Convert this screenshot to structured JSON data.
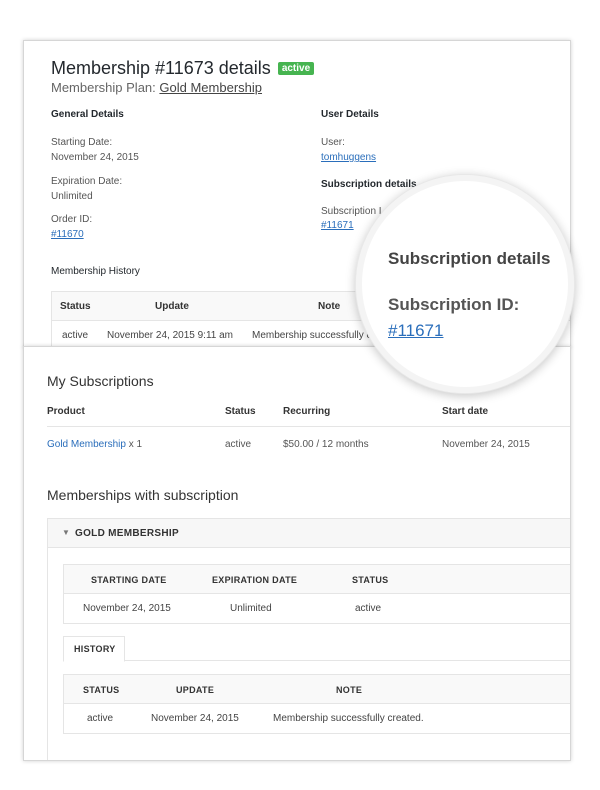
{
  "membership": {
    "title": "Membership #11673 details",
    "status_badge": "active",
    "plan_label": "Membership Plan:",
    "plan_name": "Gold Membership",
    "general_heading": "General Details",
    "starting_date_label": "Starting Date:",
    "starting_date": "November 24, 2015",
    "expiration_date_label": "Expiration Date:",
    "expiration_date": "Unlimited",
    "order_id_label": "Order ID:",
    "order_id": "#11670",
    "user_heading": "User Details",
    "user_label": "User:",
    "user": "tomhuggens",
    "subscription_heading": "Subscription details",
    "subscription_id_label": "Subscription I",
    "subscription_id": "#11671",
    "history_heading": "Membership History",
    "history_columns": [
      "Status",
      "Update",
      "Note"
    ],
    "history_row": {
      "status": "active",
      "update": "November 24, 2015 9:11 am",
      "note": "Membership successfully c"
    }
  },
  "magnifier": {
    "heading": "Subscription details",
    "id_label": "Subscription ID:",
    "id_value": "#11671"
  },
  "my_subscriptions": {
    "title": "My Subscriptions",
    "columns": [
      "Product",
      "Status",
      "Recurring",
      "Start date"
    ],
    "row": {
      "product": "Gold Membership",
      "quantity": "x 1",
      "status": "active",
      "recurring": "$50.00 / 12 months",
      "start_date": "November 24, 2015"
    }
  },
  "memberships_with_subscription": {
    "title": "Memberships with subscription",
    "accordion_title": "GOLD MEMBERSHIP",
    "details_columns": [
      "STARTING DATE",
      "EXPIRATION DATE",
      "STATUS"
    ],
    "details_row": {
      "starting_date": "November 24, 2015",
      "expiration_date": "Unlimited",
      "status": "active"
    },
    "history_tab": "HISTORY",
    "history_columns": [
      "STATUS",
      "UPDATE",
      "NOTE"
    ],
    "history_row": {
      "status": "active",
      "update": "November 24, 2015",
      "note": "Membership successfully created."
    }
  },
  "colors": {
    "badge_green": "#46b450",
    "link_blue": "#2a6ebb"
  }
}
